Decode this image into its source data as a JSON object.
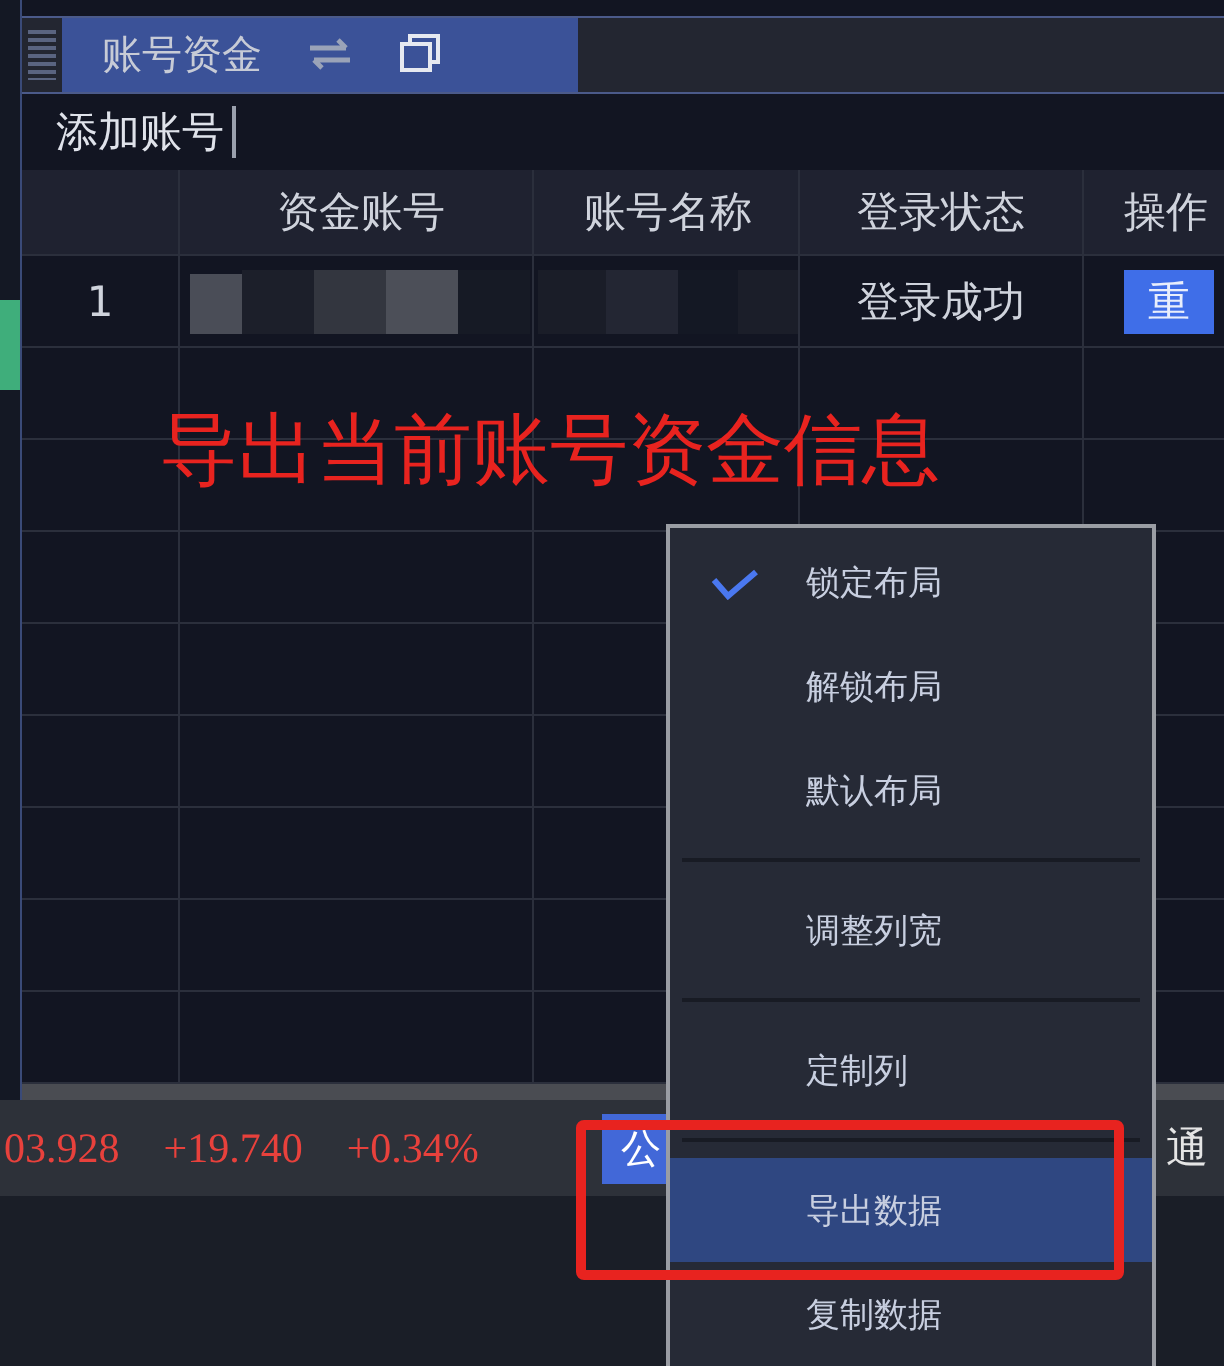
{
  "panel": {
    "tab": {
      "title": "账号资金",
      "selected": true
    }
  },
  "toolbar": {
    "add_account": "添加账号"
  },
  "table": {
    "columns": [
      "资金账号",
      "账号名称",
      "登录状态",
      "操作"
    ],
    "rows": [
      {
        "index": "1",
        "account_redacted": true,
        "name_redacted": true,
        "status": "登录成功",
        "action": "重"
      }
    ]
  },
  "annotation": {
    "text": "导出当前账号资金信息"
  },
  "status_bar": {
    "values": [
      "03.928",
      "+19.740",
      "+0.34%"
    ],
    "badge": "公",
    "trailing": "通"
  },
  "context_menu": {
    "items": [
      {
        "kind": "item",
        "label": "锁定布局",
        "checked": true,
        "selected": false
      },
      {
        "kind": "item",
        "label": "解锁布局",
        "checked": false,
        "selected": false
      },
      {
        "kind": "item",
        "label": "默认布局",
        "checked": false,
        "selected": false
      },
      {
        "kind": "separator"
      },
      {
        "kind": "item",
        "label": "调整列宽",
        "checked": false,
        "selected": false
      },
      {
        "kind": "separator"
      },
      {
        "kind": "item",
        "label": "定制列",
        "checked": false,
        "selected": false
      },
      {
        "kind": "separator"
      },
      {
        "kind": "item",
        "label": "导出数据",
        "checked": false,
        "selected": true
      },
      {
        "kind": "item",
        "label": "复制数据",
        "checked": false,
        "selected": false
      }
    ]
  }
}
